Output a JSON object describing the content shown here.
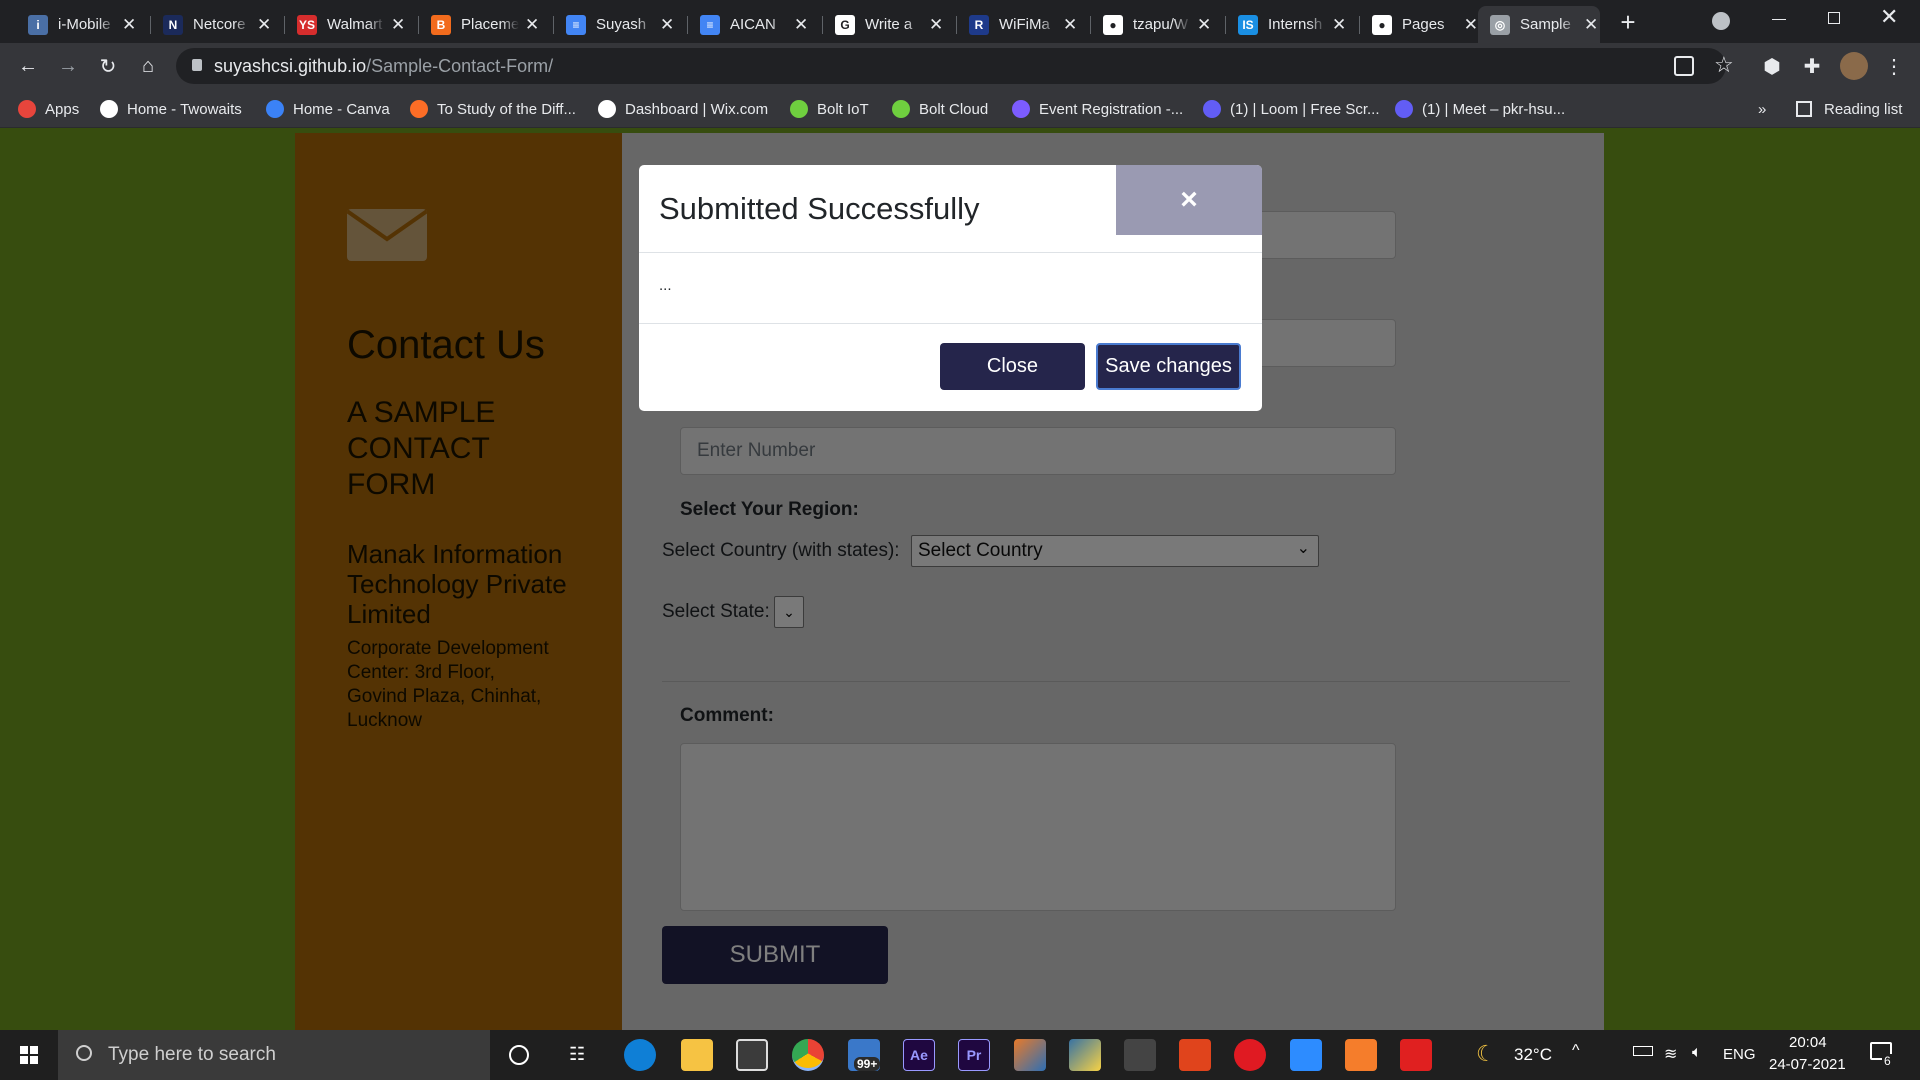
{
  "browser": {
    "tabs": [
      {
        "title": "i-Mobile",
        "fav_color": "#4a6fa5",
        "fav_letter": "i"
      },
      {
        "title": "Netcore",
        "fav_color": "#1b2a5a",
        "fav_letter": "N"
      },
      {
        "title": "Walmart",
        "fav_color": "#d62d2d",
        "fav_letter": "YS"
      },
      {
        "title": "Placement",
        "fav_color": "#f26b1d",
        "fav_letter": "B"
      },
      {
        "title": "Suyash",
        "fav_color": "#4285f4",
        "fav_letter": "≡"
      },
      {
        "title": "AICAN",
        "fav_color": "#4285f4",
        "fav_letter": "≡"
      },
      {
        "title": "Write a",
        "fav_color": "#ffffff",
        "fav_letter": "G"
      },
      {
        "title": "WiFiMa",
        "fav_color": "#1e3a8a",
        "fav_letter": "R"
      },
      {
        "title": "tzapu/W",
        "fav_color": "#ffffff",
        "fav_letter": "●"
      },
      {
        "title": "Internsh",
        "fav_color": "#1a8fe3",
        "fav_letter": "IS"
      },
      {
        "title": "Pages",
        "fav_color": "#ffffff",
        "fav_letter": "●"
      },
      {
        "title": "Sample",
        "fav_color": "#9aa0a6",
        "fav_letter": "◎",
        "active": true
      }
    ],
    "new_tab_glyph": "+",
    "close_glyph": "✕",
    "url_host": "suyashcsi.github.io",
    "url_path": "/Sample-Contact-Form/",
    "bookmarks": [
      {
        "label": "Apps",
        "icon_color": "#e8453c"
      },
      {
        "label": "Home - Twowaits",
        "icon_color": "#ffffff"
      },
      {
        "label": "Home - Canva",
        "icon_color": "#3b82f6"
      },
      {
        "label": "To Study of the Diff...",
        "icon_color": "#fc6d26"
      },
      {
        "label": "Dashboard | Wix.com",
        "icon_color": "#ffffff"
      },
      {
        "label": "Bolt IoT",
        "icon_color": "#6fcf3f"
      },
      {
        "label": "Bolt Cloud",
        "icon_color": "#6fcf3f"
      },
      {
        "label": "Event Registration -...",
        "icon_color": "#7c5cff"
      },
      {
        "label": "(1) | Loom | Free Scr...",
        "icon_color": "#625df5"
      },
      {
        "label": "(1) | Meet – pkr-hsu...",
        "icon_color": "#625df5"
      }
    ],
    "bookmarks_more": "»",
    "reading_list": "Reading list"
  },
  "page": {
    "left": {
      "title": "Contact Us",
      "subtitle_lines": [
        "A SAMPLE",
        "CONTACT",
        "FORM"
      ],
      "company_lines": [
        "Manak Information",
        "Technology Private",
        "Limited"
      ],
      "address_lines": [
        "Corporate Development",
        "Center: 3rd Floor,",
        "Govind Plaza, Chinhat,",
        "Lucknow"
      ]
    },
    "form": {
      "number_placeholder": "Enter Number",
      "region_label": "Select Your Region:",
      "country_label": "Select Country (with states):",
      "country_value": "Select Country",
      "state_label": "Select State:",
      "comment_label": "Comment:",
      "submit_label": "SUBMIT"
    },
    "modal": {
      "title": "Submitted Successfully",
      "close_x": "×",
      "body": "...",
      "close_label": "Close",
      "save_label": "Save changes"
    }
  },
  "taskbar": {
    "search_placeholder": "Type here to search",
    "badge": "99+",
    "weather": "32°C",
    "lang": "ENG",
    "time": "20:04",
    "date": "24-07-2021",
    "notifications": "6"
  }
}
